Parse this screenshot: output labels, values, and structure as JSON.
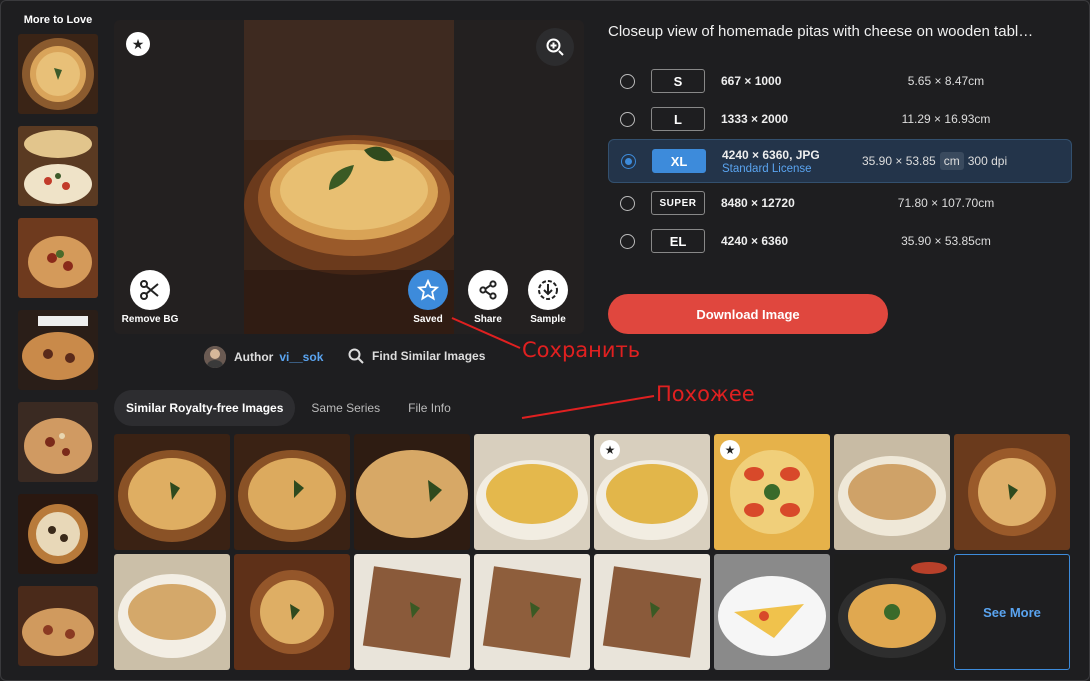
{
  "rail": {
    "title": "More to Love"
  },
  "preview": {
    "actions": {
      "remove_bg": "Remove BG",
      "saved": "Saved",
      "share": "Share",
      "sample": "Sample"
    }
  },
  "author": {
    "label": "Author",
    "name": "vi__sok"
  },
  "find_similar": "Find Similar Images",
  "tabs": [
    "Similar Royalty-free Images",
    "Same Series",
    "File Info"
  ],
  "image_title": "Closeup view of homemade pitas with cheese on wooden tabl…",
  "sizes": [
    {
      "code": "S",
      "dims": "667 × 1000",
      "cm": "5.65 × 8.47cm",
      "selected": false
    },
    {
      "code": "L",
      "dims": "1333 × 2000",
      "cm": "11.29 × 16.93cm",
      "selected": false
    },
    {
      "code": "XL",
      "dims": "4240 × 6360, JPG",
      "license": "Standard License",
      "cm_value": "35.90 × 53.85",
      "unit": "cm",
      "dpi": "300 dpi",
      "selected": true
    },
    {
      "code": "SUPER",
      "dims": "8480 × 12720",
      "cm": "71.80 × 107.70cm",
      "selected": false
    },
    {
      "code": "EL",
      "dims": "4240 × 6360",
      "cm": "35.90 × 53.85cm",
      "selected": false
    }
  ],
  "download_label": "Download Image",
  "see_more": "See More",
  "annotations": {
    "save": "Сохранить",
    "similar": "Похожее"
  },
  "colors": {
    "accent": "#3d8bdb",
    "download": "#e0473e",
    "annotation": "#e02020"
  }
}
